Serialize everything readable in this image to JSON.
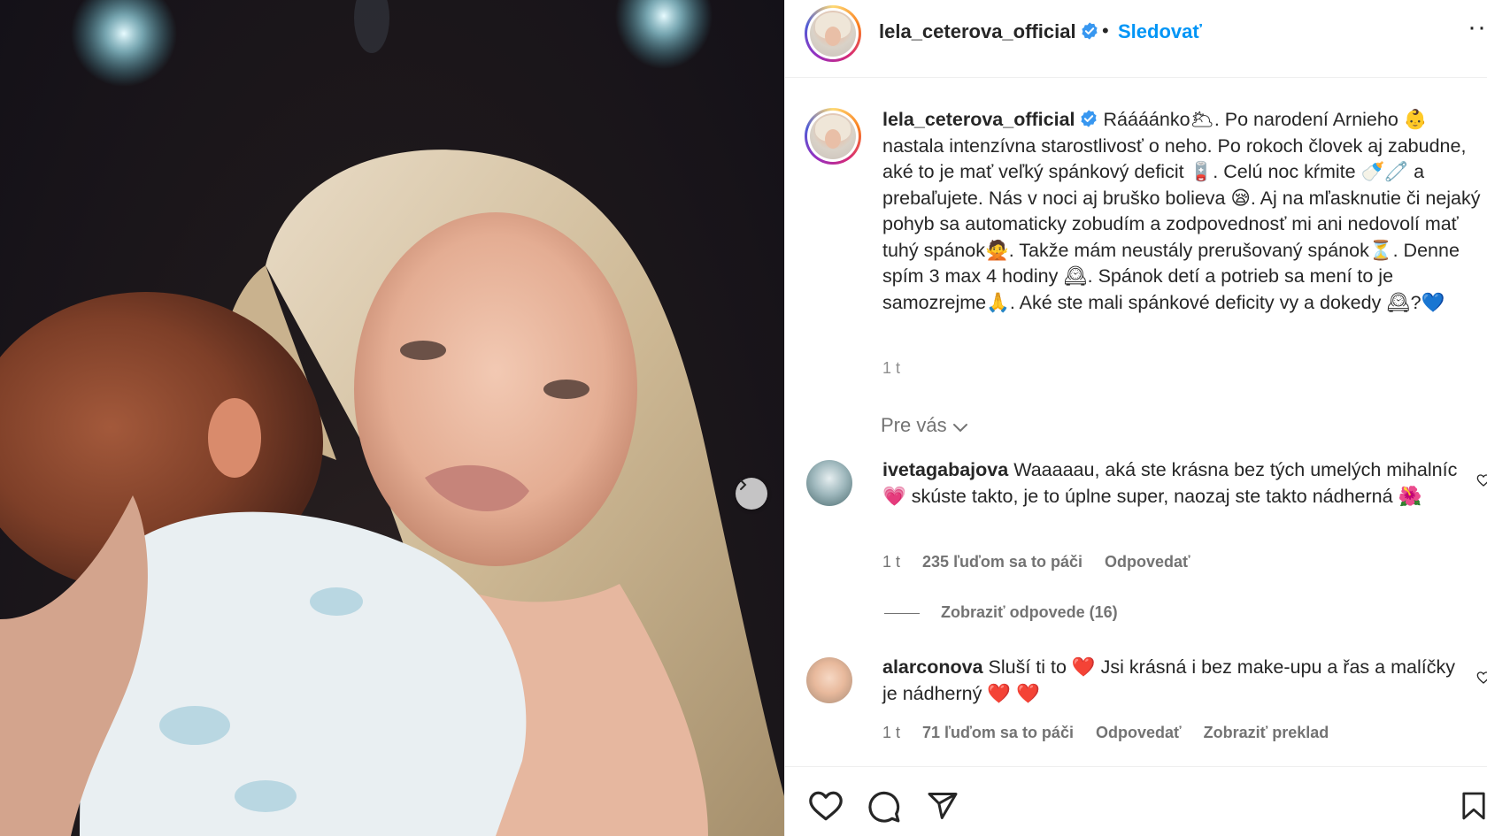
{
  "post": {
    "username": "lela_ceterova_official",
    "follow_label": "Sledovať",
    "dot": "•",
    "more": "···"
  },
  "caption": {
    "username": "lela_ceterova_official",
    "text": "Ráááánko🌥. Po narodení Arnieho 👶 nastala intenzívna starostlivosť o neho. Po rokoch človek aj zabudne, aké to je mať veľký spánkový deficit 🪫. Celú noc kŕmite 🍼🧷 a prebaľujete. Nás v noci aj bruško bolieva 😪. Aj na mľasknutie či nejaký pohyb sa automaticky zobudím a zodpovednosť mi ani nedovolí mať tuhý spánok🙅. Takže mám neustály prerušovaný spánok⏳. Denne spím 3 max 4 hodiny 🕰. Spánok detí a potrieb sa mení to je samozrejme🙏. Aké ste mali spánkové deficity vy a dokedy 🕰?💙",
    "time": "1 t"
  },
  "filter": {
    "label": "Pre vás"
  },
  "comments": [
    {
      "username": "ivetagabajova",
      "text": "Waaaaau, aká ste krásna bez tých umelých mihalníc💗 skúste takto, je to úplne super, naozaj ste takto nádherná 🌺",
      "time": "1 t",
      "likes": "235 ľuďom sa to páči",
      "reply": "Odpovedať",
      "view_replies": "Zobraziť odpovede (16)"
    },
    {
      "username": "alarconova",
      "text": "Sluší ti to ❤️ Jsi krásná i bez make-upu a řas a malíčky je nádherný ❤️ ❤️",
      "time": "1 t",
      "likes": "71 ľuďom sa to páči",
      "reply": "Odpovedať",
      "translate": "Zobraziť preklad"
    }
  ],
  "icons": {
    "verified": "verified-badge-icon",
    "like": "heart-icon",
    "comment": "comment-icon",
    "share": "send-icon",
    "save": "bookmark-icon",
    "next": "chevron-right-icon",
    "filter": "chevron-down-icon"
  },
  "colors": {
    "accent": "#0095f6",
    "text": "#262626",
    "muted": "#737373"
  }
}
